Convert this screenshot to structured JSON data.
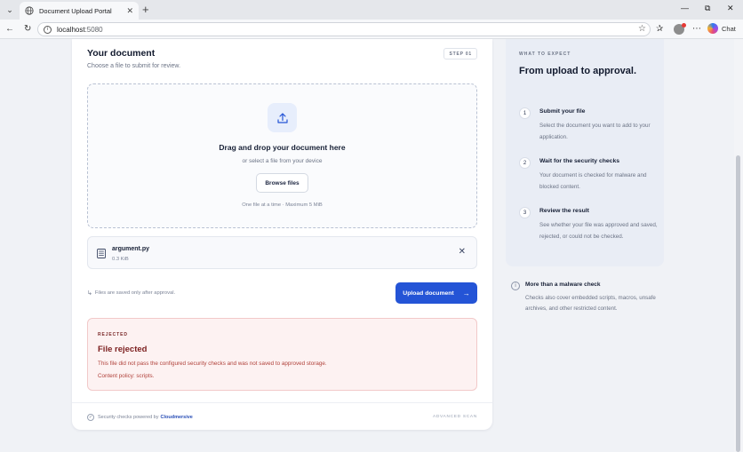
{
  "browser": {
    "tab_title": "Document Upload Portal",
    "url_host": "localhost",
    "url_port": ":5080",
    "chat_label": "Chat"
  },
  "upload_card": {
    "title": "Your document",
    "subtitle": "Choose a file to submit for review.",
    "step_badge": "STEP 01",
    "dropzone": {
      "title": "Drag and drop your document here",
      "subtitle": "or select a file from your device",
      "browse_label": "Browse files",
      "hint": "One file at a time · Maximum 5 MiB"
    },
    "file": {
      "name": "argument.py",
      "size": "0.3 KiB"
    },
    "note": "Files are saved only after approval.",
    "upload_label": "Upload document",
    "result": {
      "eyebrow": "REJECTED",
      "title": "File rejected",
      "message": "This file did not pass the configured security checks and was not saved to approved storage.",
      "policy": "Content policy: scripts."
    },
    "footer": {
      "powered_by": "Security checks powered by",
      "brand": "Cloudmersive",
      "mode": "ADVANCED SCAN"
    }
  },
  "sidebar": {
    "eyebrow": "WHAT TO EXPECT",
    "title": "From upload to approval.",
    "steps": [
      {
        "num": "1",
        "title": "Submit your file",
        "desc": "Select the document you want to add to your application."
      },
      {
        "num": "2",
        "title": "Wait for the security checks",
        "desc": "Your document is checked for malware and blocked content."
      },
      {
        "num": "3",
        "title": "Review the result",
        "desc": "See whether your file was approved and saved, rejected, or could not be checked."
      }
    ],
    "info": {
      "title": "More than a malware check",
      "desc": "Checks also cover embedded scripts, macros, unsafe archives, and other restricted content."
    }
  },
  "colors": {
    "primary": "#2454d6",
    "rejected_bg": "#fdf2f2",
    "rejected_text": "#7c1f1f",
    "brand_link": "#2a4fb7"
  }
}
